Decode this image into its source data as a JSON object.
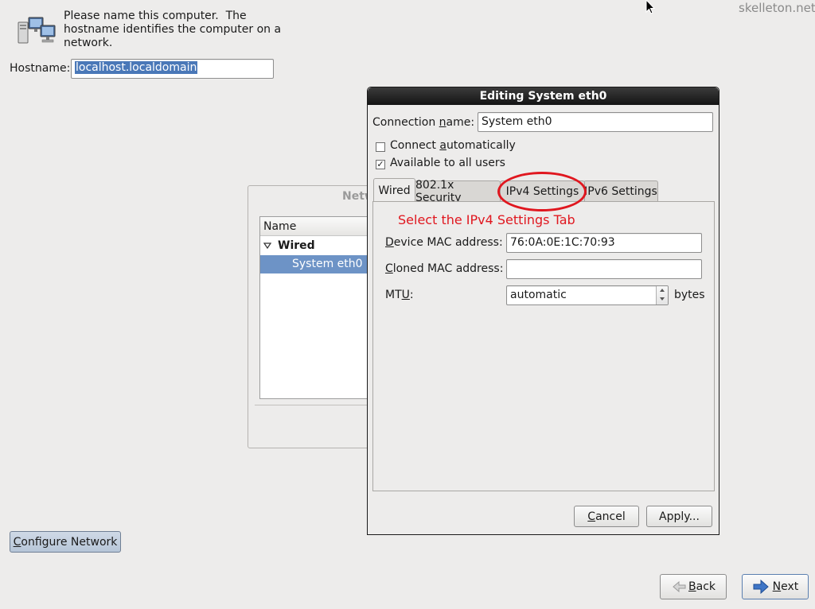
{
  "watermark": "skelleton.net",
  "intro": {
    "line1": "Please name this computer.  The",
    "line2": "hostname identifies the computer on a",
    "line3": "network.",
    "icon": "network-computers-icon"
  },
  "hostname": {
    "label": "Hostname:",
    "value": "localhost.localdomain"
  },
  "background_panel": {
    "title_partial": "Netw",
    "column_name": "Name",
    "group": "Wired",
    "item": "System eth0"
  },
  "configure_button": "Configure Network",
  "nav": {
    "back": "Back",
    "next": "Next"
  },
  "dialog": {
    "title": "Editing System eth0",
    "connection_name_label_pre": "Connection ",
    "connection_name_label_u": "n",
    "connection_name_label_post": "ame:",
    "connection_name_value": "System eth0",
    "connect_auto_pre": "Connect ",
    "connect_auto_u": "a",
    "connect_auto_post": "utomatically",
    "connect_auto_checked": false,
    "all_users": "Available to all users",
    "all_users_checked": true,
    "tabs": [
      "Wired",
      "802.1x Security",
      "IPv4 Settings",
      "IPv6 Settings"
    ],
    "active_tab": "Wired",
    "annotation": "Select the IPv4 Settings Tab",
    "device_mac_pre": "",
    "device_mac_u": "D",
    "device_mac_post": "evice MAC address:",
    "device_mac_value": "76:0A:0E:1C:70:93",
    "cloned_mac_u": "C",
    "cloned_mac_post": "loned MAC address:",
    "cloned_mac_value": "",
    "mtu_pre": "MT",
    "mtu_u": "U",
    "mtu_post": ":",
    "mtu_value": "automatic",
    "mtu_unit": "bytes",
    "cancel": "Cancel",
    "apply": "Apply..."
  },
  "colors": {
    "annotation": "#e0171f",
    "selection": "#4a78b8"
  }
}
